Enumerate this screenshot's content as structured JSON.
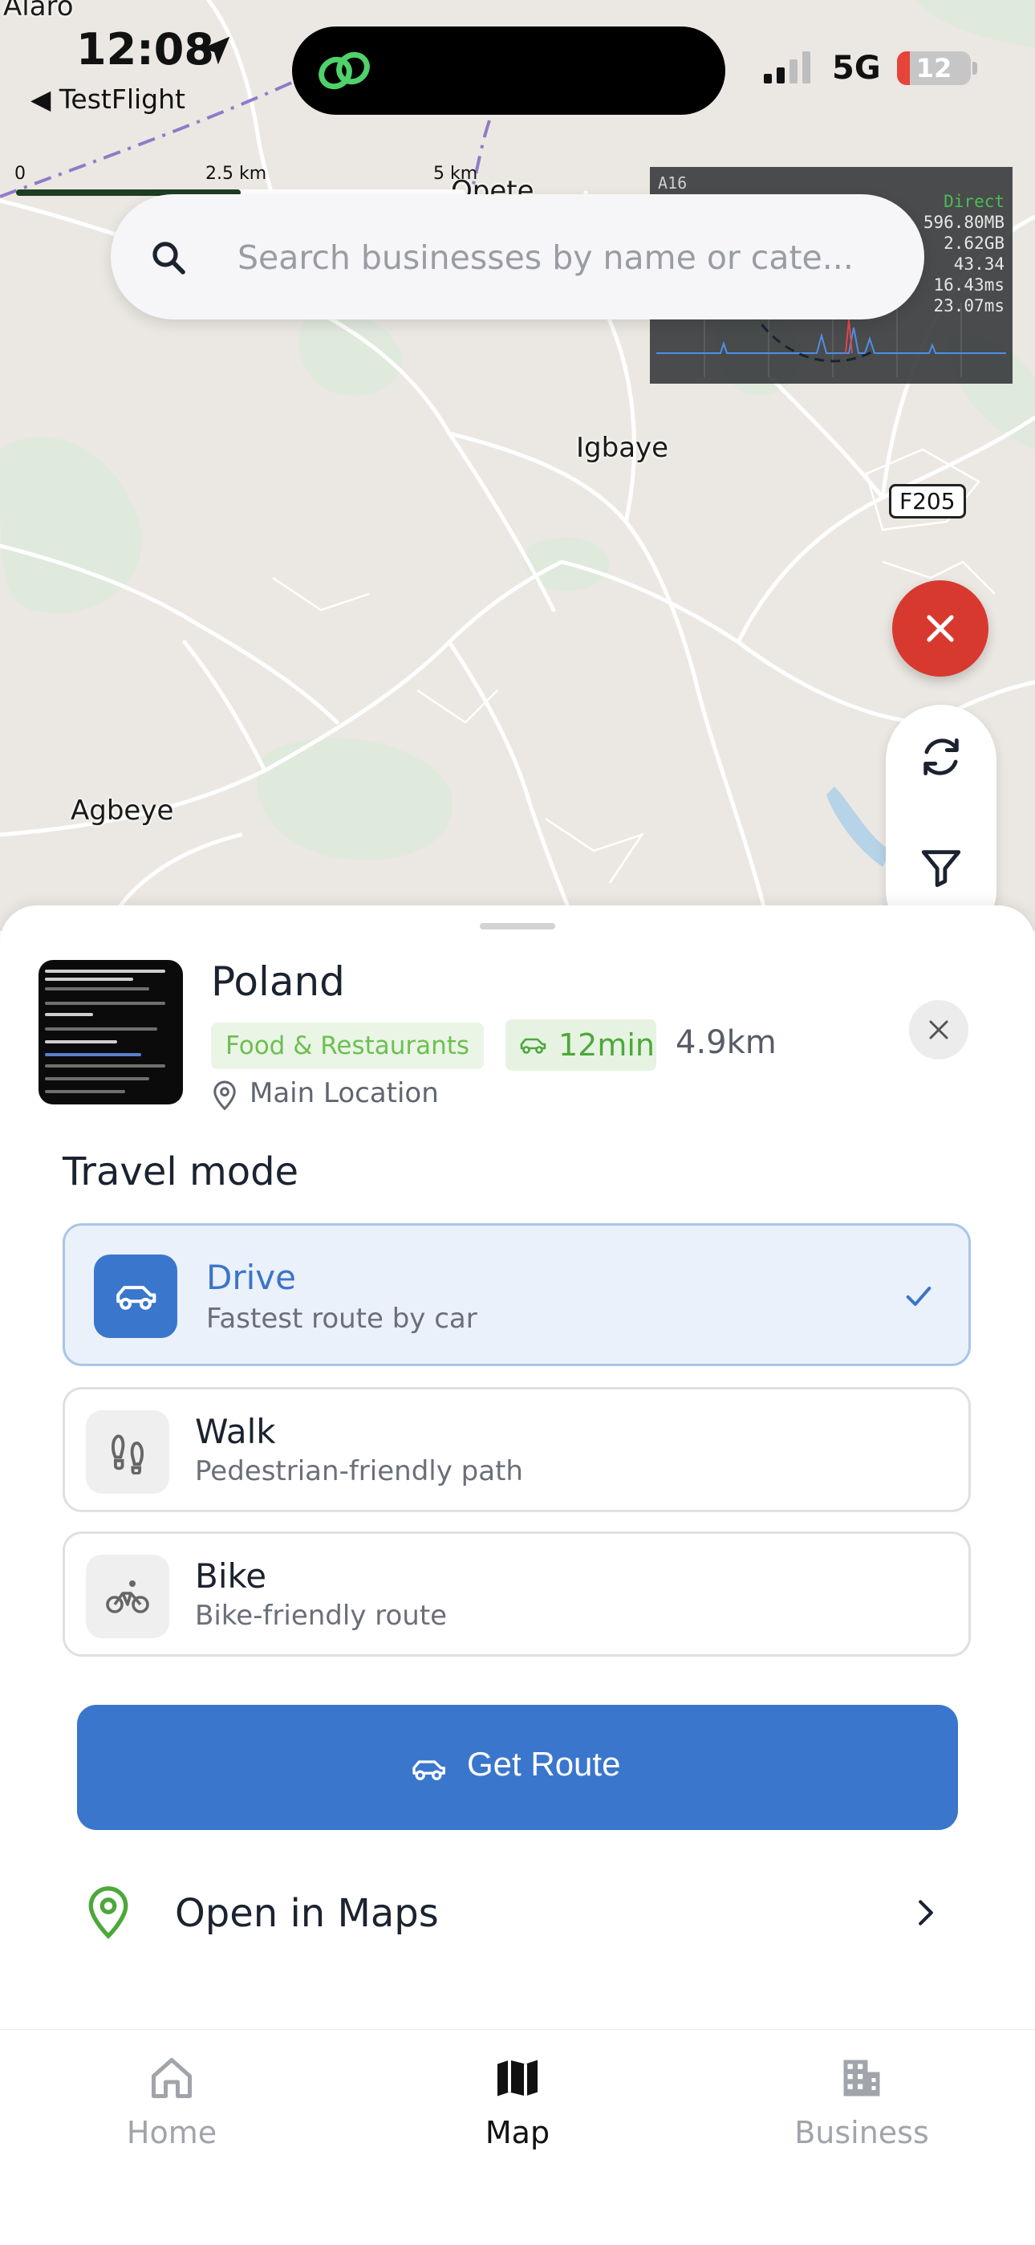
{
  "status_bar": {
    "time": "12:08",
    "back_app": "◀ TestFlight",
    "network": "5G",
    "battery": "12"
  },
  "map": {
    "top_left_label": "Alaro",
    "scale": {
      "zero": "0",
      "mid": "2.5 km",
      "max": "5 km"
    },
    "labels": {
      "top_place": "Opete",
      "igbaye": "Igbaye",
      "agbeye": "Agbeye",
      "road": "F205"
    }
  },
  "search": {
    "placeholder": "Search businesses by name or cate..."
  },
  "perf_overlay": {
    "chip": "A16",
    "mode": "Direct",
    "memory": "596.80MB",
    "total": "2.62GB",
    "fps": "43.34",
    "frame_ms": "16.43ms",
    "gpu_ms": "23.07ms"
  },
  "business": {
    "name": "Poland",
    "category": "Food & Restaurants",
    "eta": "12min",
    "distance": "4.9km",
    "location": "Main Location"
  },
  "travel": {
    "title": "Travel mode",
    "modes": [
      {
        "title": "Drive",
        "subtitle": "Fastest route by car",
        "icon": "car-icon",
        "selected": true
      },
      {
        "title": "Walk",
        "subtitle": "Pedestrian-friendly path",
        "icon": "footprints-icon",
        "selected": false
      },
      {
        "title": "Bike",
        "subtitle": "Bike-friendly route",
        "icon": "bike-icon",
        "selected": false
      }
    ]
  },
  "actions": {
    "get_route": "Get Route",
    "open_in_maps": "Open in Maps"
  },
  "tabs": [
    {
      "label": "Home",
      "icon": "home-icon",
      "active": false
    },
    {
      "label": "Map",
      "icon": "map-icon",
      "active": true
    },
    {
      "label": "Business",
      "icon": "building-icon",
      "active": false
    }
  ],
  "colors": {
    "primary": "#3b76cd",
    "danger": "#d8392f",
    "success": "#4ca83a",
    "map_bg": "#ebe8e3"
  }
}
